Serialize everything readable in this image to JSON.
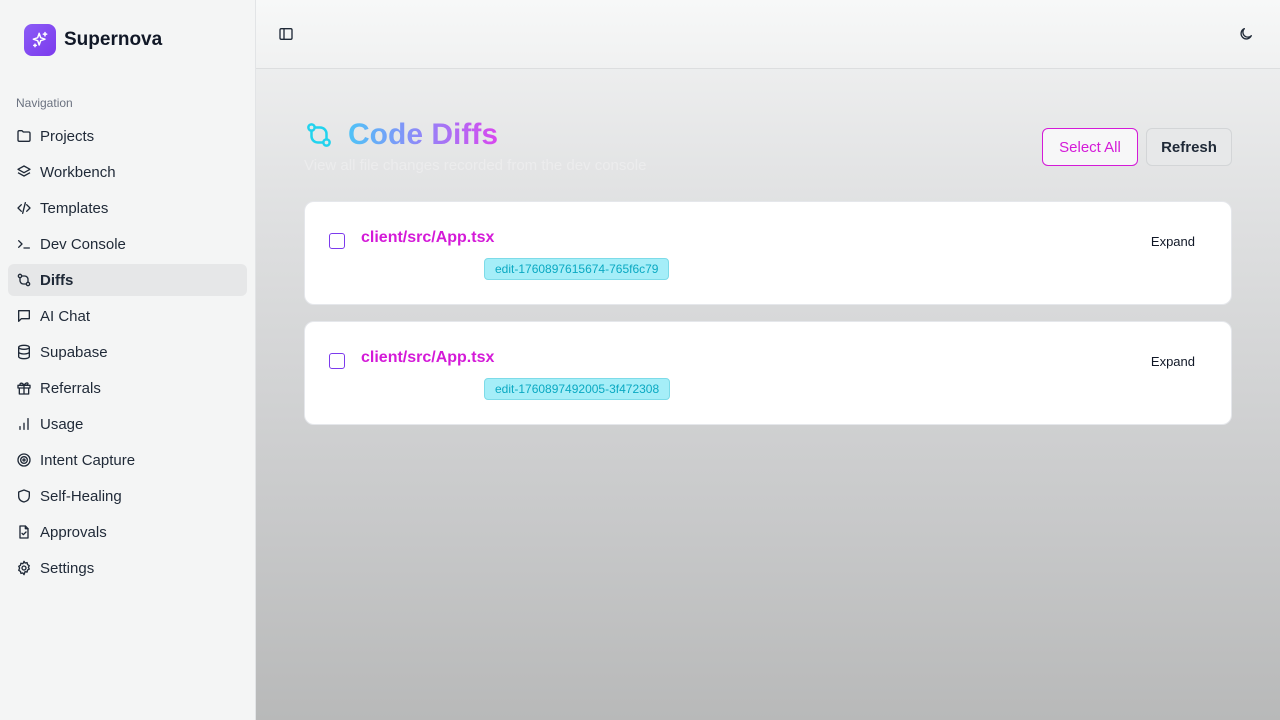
{
  "app": {
    "name": "Supernova"
  },
  "sidebar": {
    "heading": "Navigation",
    "items": [
      {
        "label": "Projects",
        "icon": "folder-icon"
      },
      {
        "label": "Workbench",
        "icon": "layers-icon"
      },
      {
        "label": "Templates",
        "icon": "code-icon"
      },
      {
        "label": "Dev Console",
        "icon": "terminal-icon"
      },
      {
        "label": "Diffs",
        "icon": "git-compare-icon",
        "active": true
      },
      {
        "label": "AI Chat",
        "icon": "chat-icon"
      },
      {
        "label": "Supabase",
        "icon": "database-icon"
      },
      {
        "label": "Referrals",
        "icon": "gift-icon"
      },
      {
        "label": "Usage",
        "icon": "bar-chart-icon"
      },
      {
        "label": "Intent Capture",
        "icon": "target-icon"
      },
      {
        "label": "Self-Healing",
        "icon": "shield-icon"
      },
      {
        "label": "Approvals",
        "icon": "file-check-icon"
      },
      {
        "label": "Settings",
        "icon": "gear-icon"
      }
    ]
  },
  "page": {
    "title": "Code Diffs",
    "subtitle": "View all file changes recorded from the dev console",
    "select_all_label": "Select All",
    "refresh_label": "Refresh"
  },
  "diffs": [
    {
      "file": "client/src/App.tsx",
      "edit_id": "edit-1760897615674-765f6c79",
      "expand_label": "Expand",
      "checked": false
    },
    {
      "file": "client/src/App.tsx",
      "edit_id": "edit-1760897492005-3f472308",
      "expand_label": "Expand",
      "checked": false
    }
  ],
  "colors": {
    "accent_magenta": "#d41ad8",
    "brand_purple": "#7c3aed",
    "tag_cyan": "#a5eef8"
  }
}
